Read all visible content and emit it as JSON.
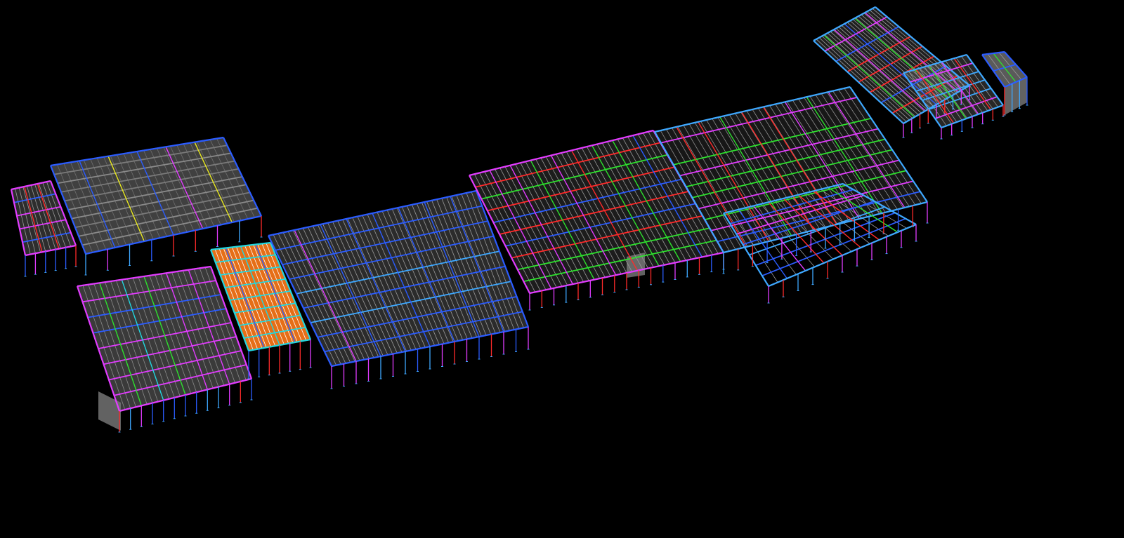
{
  "viewport": {
    "background": "#000000",
    "view_mode": "wireframe-3d",
    "content": "structural-steel-model"
  },
  "palette": {
    "beam_blue": "#2b5cff",
    "beam_light_blue": "#3ea8ff",
    "beam_magenta": "#e23cff",
    "beam_red": "#ff2a2a",
    "beam_green": "#2ee02e",
    "beam_orange": "#ff7a1a",
    "beam_cyan": "#22d7e0",
    "beam_yellow": "#e8e820",
    "deck_gray": "#808080",
    "secondary_gray": "#9a9a9a",
    "purple": "#8c5cff"
  },
  "model_sections": [
    {
      "name": "roof-deck-west",
      "fill": "deck_gray",
      "edge": "beam_blue"
    },
    {
      "name": "stair-core-west",
      "fill": "deck_gray",
      "edge": "beam_magenta"
    },
    {
      "name": "orange-floor-bay",
      "fill": "beam_orange",
      "edge": "beam_cyan"
    },
    {
      "name": "central-roof-bay",
      "fill": "secondary_gray",
      "edge": "beam_blue"
    },
    {
      "name": "middle-framing-bay",
      "fill": "secondary_gray",
      "edge": "beam_magenta"
    },
    {
      "name": "east-framing-wing",
      "fill": "secondary_gray",
      "edge": "beam_light_blue"
    },
    {
      "name": "east-end-block",
      "fill": "deck_gray",
      "edge": "beam_blue"
    }
  ]
}
